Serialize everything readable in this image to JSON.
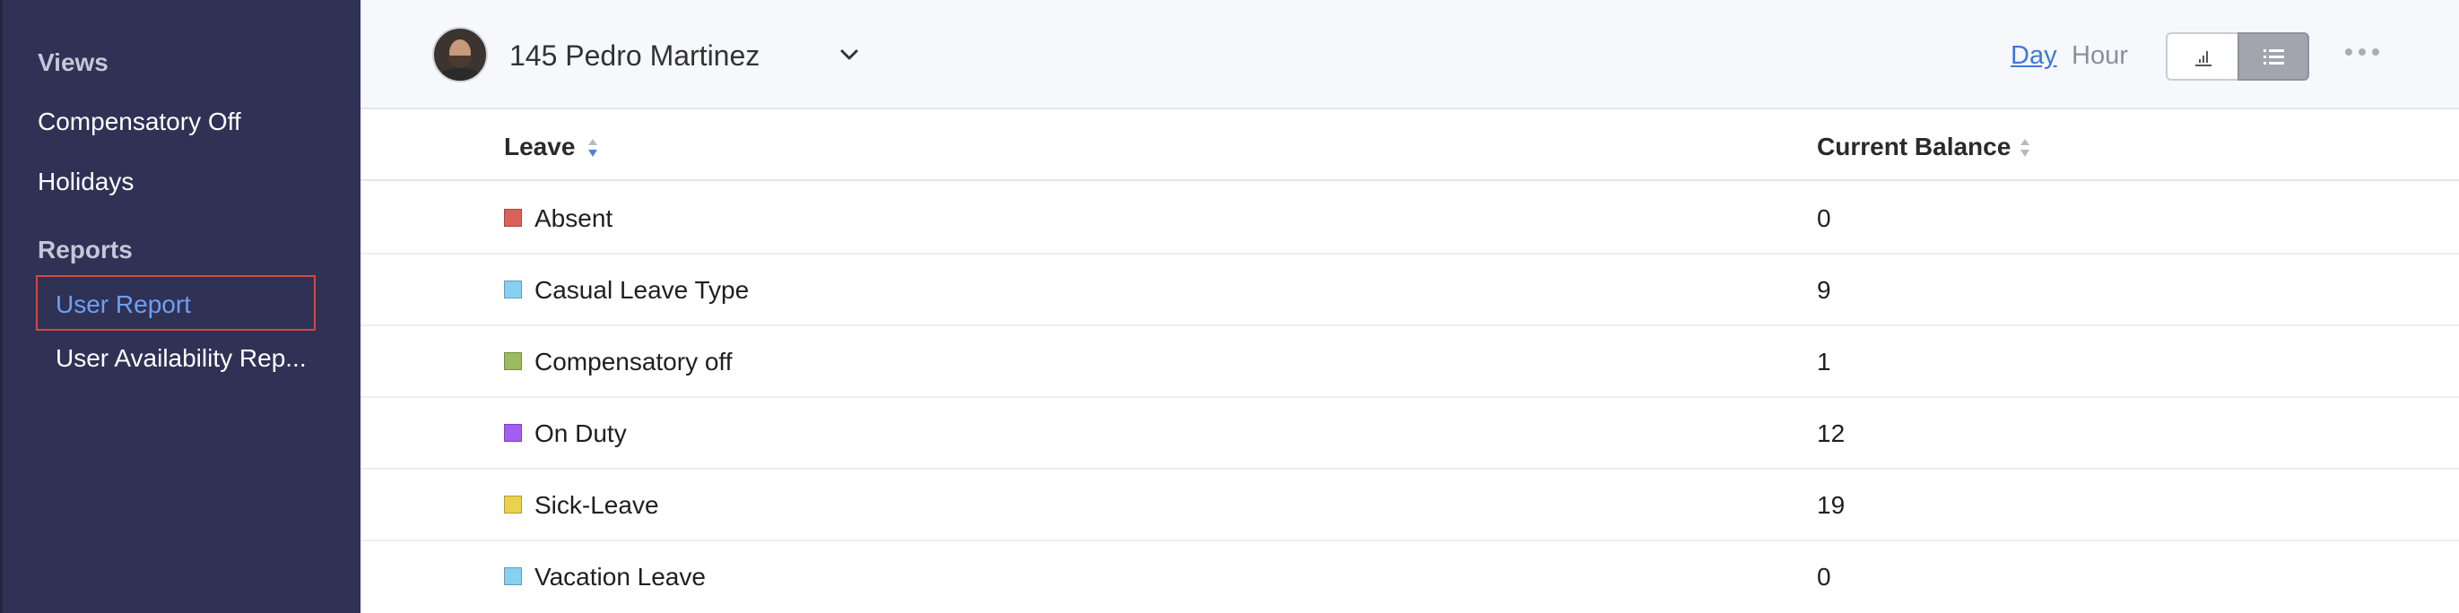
{
  "sidebar": {
    "views_heading": "Views",
    "items": [
      {
        "label": "Compensatory Off"
      },
      {
        "label": "Holidays"
      }
    ],
    "reports_heading": "Reports",
    "reports": [
      {
        "label": "User Report",
        "active": true
      },
      {
        "label": "User Availability Rep..."
      }
    ]
  },
  "header": {
    "user_name": "145 Pedro Martinez",
    "avatar_icon": "user-avatar",
    "dropdown_icon": "chevron-down-icon",
    "day_label": "Day",
    "hour_label": "Hour",
    "chart_view_icon": "bar-chart-icon",
    "list_view_icon": "list-icon",
    "more_icon": "more-horizontal-icon"
  },
  "table": {
    "columns": [
      "Leave",
      "Current Balance"
    ],
    "rows": [
      {
        "leave": "Absent",
        "color": "#d9625a",
        "balance": "0"
      },
      {
        "leave": "Casual Leave Type",
        "color": "#86d0f2",
        "balance": "9"
      },
      {
        "leave": "Compensatory off",
        "color": "#9bbb5c",
        "balance": "1"
      },
      {
        "leave": "On Duty",
        "color": "#a45ef0",
        "balance": "12"
      },
      {
        "leave": "Sick-Leave",
        "color": "#ebd24d",
        "balance": "19"
      },
      {
        "leave": "Vacation Leave",
        "color": "#86d0f2",
        "balance": "0"
      }
    ]
  },
  "colors": {
    "sidebar_bg": "#2f3155",
    "active_border": "#d5473f",
    "active_text": "#6ea0f0",
    "link_blue": "#3d78d8"
  }
}
